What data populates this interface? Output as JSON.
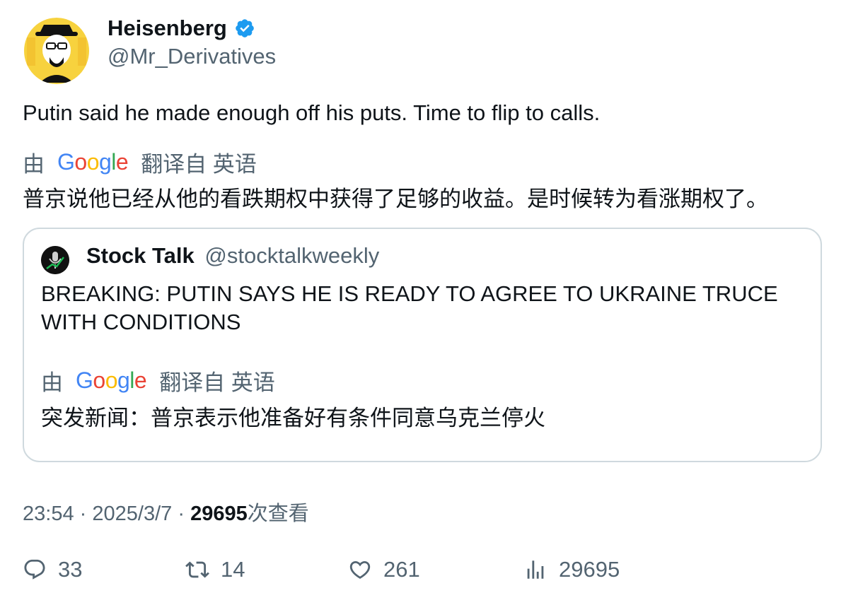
{
  "author": {
    "display_name": "Heisenberg",
    "handle": "@Mr_Derivatives",
    "verified": true
  },
  "tweet": {
    "text": "Putin said he made enough off his puts. Time to flip to calls.",
    "translation": {
      "prefix": "由",
      "provider": "Google",
      "label": "翻译自 英语",
      "text": "普京说他已经从他的看跌期权中获得了足够的收益。是时候转为看涨期权了。"
    }
  },
  "quote": {
    "display_name": "Stock Talk",
    "handle": "@stocktalkweekly",
    "text": "BREAKING: PUTIN SAYS HE IS READY TO AGREE TO UKRAINE TRUCE WITH CONDITIONS",
    "translation": {
      "prefix": "由",
      "provider": "Google",
      "label": "翻译自 英语",
      "text": "突发新闻：普京表示他准备好有条件同意乌克兰停火"
    }
  },
  "meta": {
    "time": "23:54",
    "separator": "·",
    "date": "2025/3/7",
    "views": "29695",
    "views_suffix": "次查看"
  },
  "actions": {
    "replies": "33",
    "retweets": "14",
    "likes": "261",
    "views": "29695"
  },
  "colors": {
    "text": "#0f1419",
    "secondary": "#536471",
    "verified_blue": "#1d9bf0",
    "border": "#cfd9de"
  },
  "icons": {
    "verified": "verified-badge-icon",
    "reply": "reply-icon",
    "retweet": "retweet-icon",
    "like": "heart-icon",
    "views": "bar-chart-icon"
  }
}
